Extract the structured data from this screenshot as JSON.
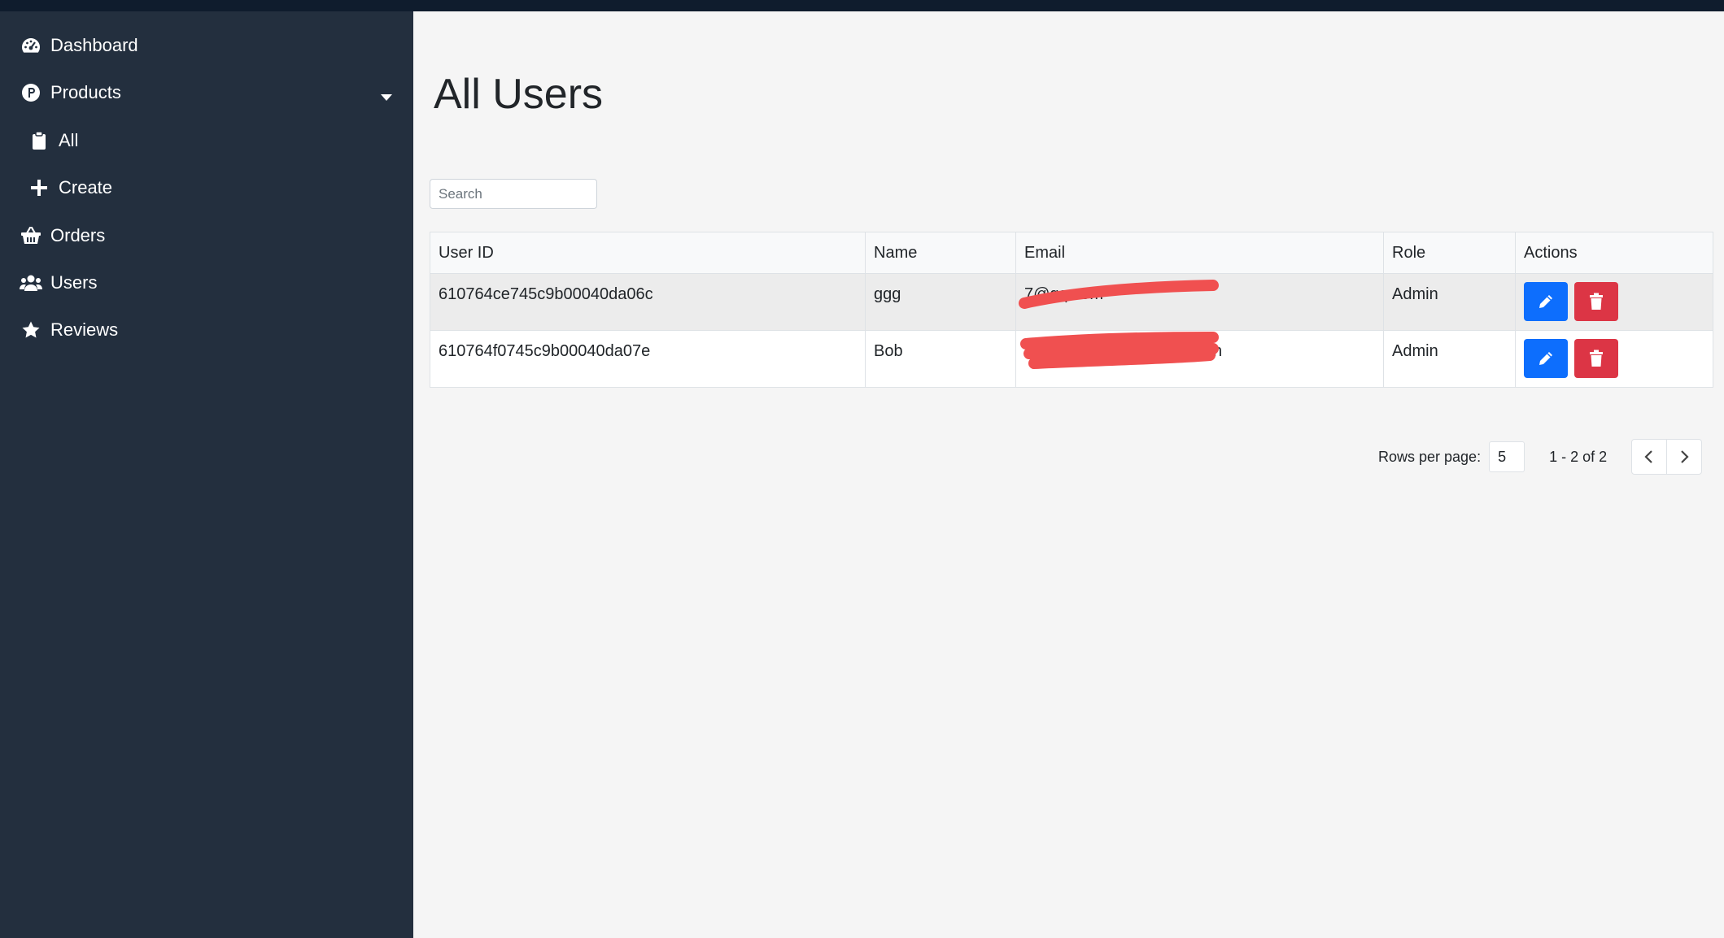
{
  "sidebar": {
    "items": [
      {
        "label": "Dashboard",
        "icon": "tachometer-icon"
      },
      {
        "label": "Products",
        "icon": "product-p-icon"
      },
      {
        "label": "All",
        "icon": "clipboard-icon"
      },
      {
        "label": "Create",
        "icon": "plus-icon"
      },
      {
        "label": "Orders",
        "icon": "shopping-basket-icon"
      },
      {
        "label": "Users",
        "icon": "users-icon"
      },
      {
        "label": "Reviews",
        "icon": "star-icon"
      }
    ]
  },
  "main": {
    "title": "All Users",
    "search_placeholder": "Search",
    "table": {
      "columns": [
        "User ID",
        "Name",
        "Email",
        "Role",
        "Actions"
      ],
      "rows": [
        {
          "user_id": "610764ce745c9b00040da06c",
          "name": "ggg",
          "email": "7@qq.com",
          "role": "Admin"
        },
        {
          "user_id": "610764f0745c9b00040da07e",
          "name": "Bob",
          "email": "n",
          "role": "Admin"
        }
      ]
    },
    "pagination": {
      "rows_per_page_label": "Rows per page:",
      "rows_per_page": "5",
      "range": "1 - 2 of 2"
    }
  },
  "colors": {
    "sidebar_bg": "#232f3e",
    "edit_button": "#0d6efd",
    "delete_button": "#dc3545",
    "redaction": "#f05050"
  }
}
